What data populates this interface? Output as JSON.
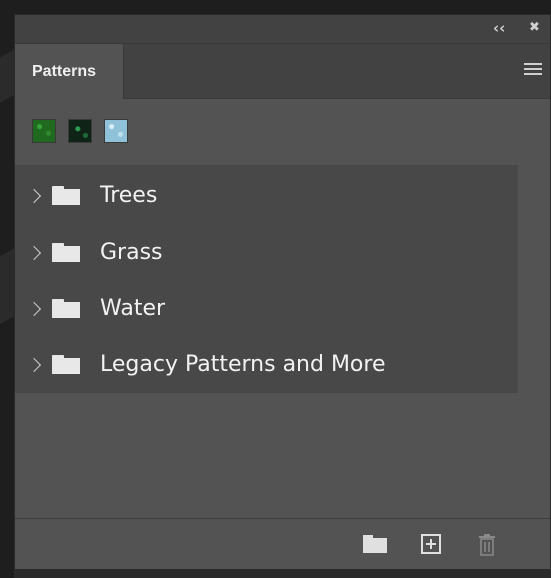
{
  "panel": {
    "collapse_icon": "double-chevron-left-icon",
    "close_icon": "close-icon",
    "collapse_glyph": "‹‹",
    "close_glyph": "✖",
    "tab_label": "Patterns",
    "menu_icon": "hamburger-menu-icon"
  },
  "recent_swatches": [
    {
      "name": "green-leaves-pattern",
      "color": "#1f6a1f",
      "accent": "#39a339"
    },
    {
      "name": "dark-green-pattern",
      "color": "#0f2416",
      "accent": "#2e9a55"
    },
    {
      "name": "water-pattern",
      "color": "#8fc2d8",
      "accent": "#d8eef8"
    }
  ],
  "groups": [
    {
      "label": "Trees"
    },
    {
      "label": "Grass"
    },
    {
      "label": "Water"
    },
    {
      "label": "Legacy Patterns and More"
    }
  ],
  "footer": {
    "new_group_icon": "folder-icon",
    "new_pattern_icon": "add-square-icon",
    "delete_icon": "trash-icon"
  }
}
